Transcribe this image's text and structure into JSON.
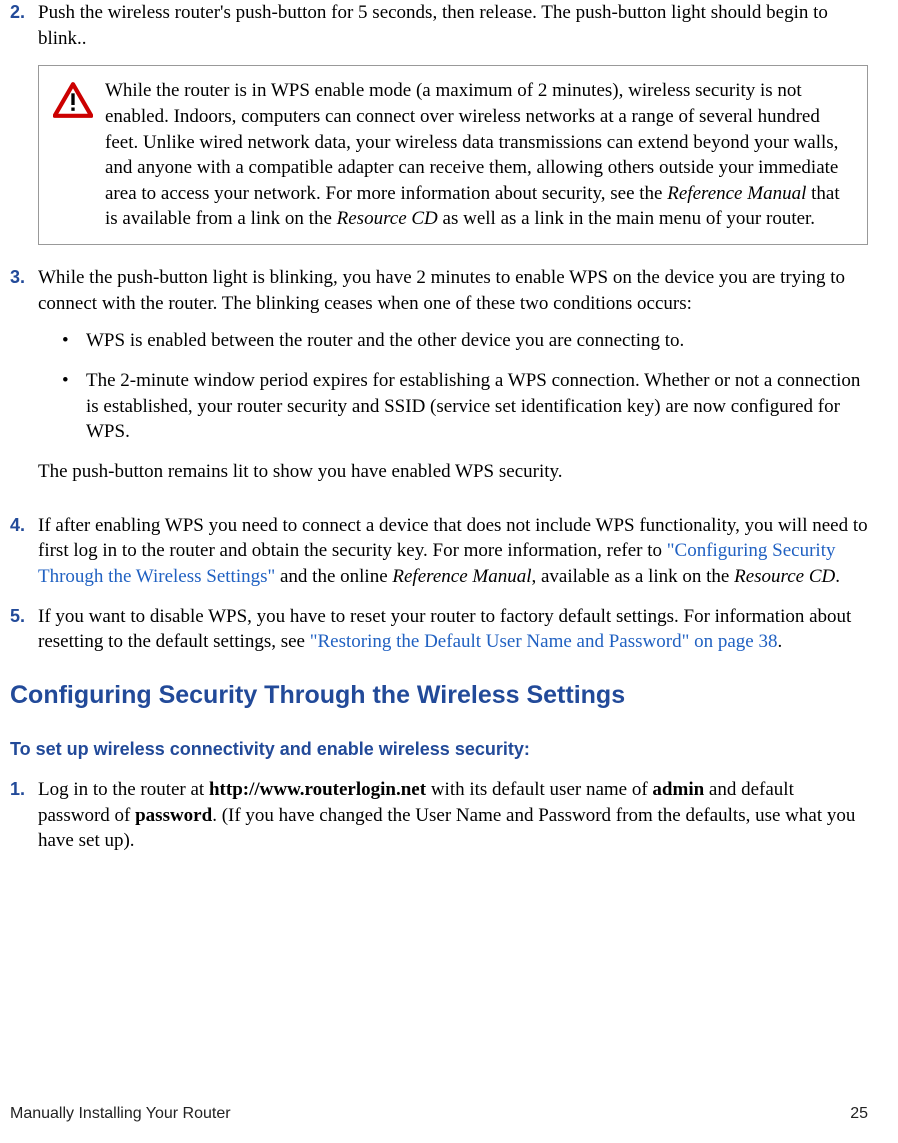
{
  "steps": {
    "s2": {
      "num": "2.",
      "text": "Push the wireless router's push-button for 5 seconds, then release. The push-button light should begin to blink.."
    },
    "warning": "While the router is in WPS enable mode (a maximum of 2 minutes), wireless security is not enabled. Indoors, computers can connect over wireless networks at a range of several hundred feet. Unlike wired network data, your wireless data transmissions can extend beyond your walls, and anyone with a compatible adapter can receive them, allowing others outside your immediate area to access your network. For more information about security, see the ",
    "warning_ref1": "Reference Manual",
    "warning_mid": " that is available from a link on the ",
    "warning_ref2": "Resource CD",
    "warning_end": " as well as a link in the main menu of your router.",
    "s3": {
      "num": "3.",
      "text": "While the push-button light is blinking, you have 2 minutes to enable WPS on the device you are trying to connect with the router. The blinking ceases when one of these two conditions occurs:",
      "b1": "WPS is enabled between the router and the other device you are connecting to.",
      "b2": "The 2-minute window period expires for establishing a WPS connection. Whether or not a connection is established, your router security and SSID (service set identification key) are now configured for WPS.",
      "after": "The push-button remains lit to show you have enabled WPS security."
    },
    "s4": {
      "num": "4.",
      "pre": "If after enabling WPS you need to connect a device that does not include WPS functionality, you will need to first log in to the router and obtain the security key. For more information, refer to ",
      "link": "\"Configuring Security Through the Wireless Settings\"",
      "mid": " and the online ",
      "ref": "Reference Manual",
      "mid2": ", available as a link on the ",
      "ref2": "Resource CD",
      "end": "."
    },
    "s5": {
      "num": "5.",
      "pre": "If you want to disable WPS, you have to reset your router to factory default settings. For information about resetting to the default settings, see ",
      "link": "\"Restoring the Default User Name and Password\" on page 38",
      "end": "."
    }
  },
  "section": {
    "heading": "Configuring Security Through the Wireless Settings",
    "subheading": "To set up wireless connectivity and enable wireless security:",
    "s1": {
      "num": "1.",
      "pre": "Log in to the router at ",
      "url": "http://www.routerlogin.net",
      "mid1": " with its default user name of ",
      "user": "admin",
      "mid2": " and default password of ",
      "pass": "password",
      "end": ". (If you have changed the User Name and Password from the defaults, use what you have set up)."
    }
  },
  "footer": {
    "left": "Manually Installing Your Router",
    "right": "25"
  }
}
